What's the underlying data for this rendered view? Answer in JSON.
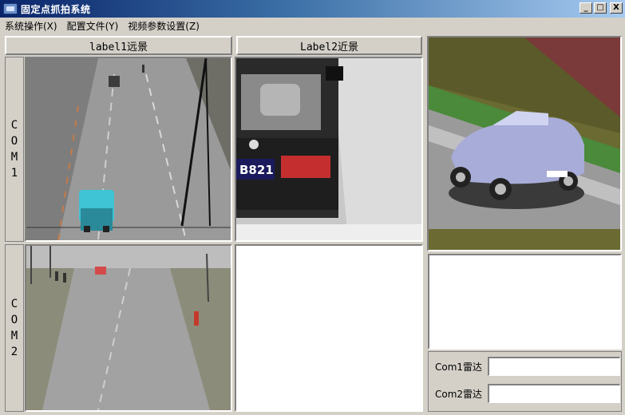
{
  "window": {
    "title": "固定点抓拍系统",
    "buttons": {
      "minimize": "_",
      "maximize": "□",
      "close": "X"
    }
  },
  "menu": [
    {
      "label": "系统操作(X)"
    },
    {
      "label": "配置文件(Y)"
    },
    {
      "label": "视频参数设置(Z)"
    }
  ],
  "panels": {
    "label1": "label1远景",
    "label2": "Label2近景"
  },
  "rows": {
    "com1": [
      "C",
      "O",
      "M",
      "1"
    ],
    "com2": [
      "C",
      "O",
      "M",
      "2"
    ]
  },
  "license_plate": "B821",
  "radar": {
    "com1_label": "Com1雷达",
    "com1_value": "",
    "com2_label": "Com2雷达",
    "com2_value": ""
  }
}
